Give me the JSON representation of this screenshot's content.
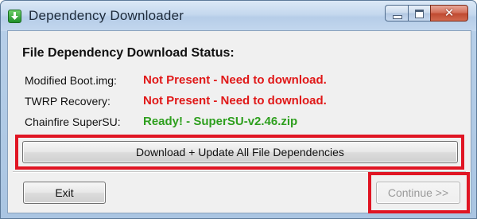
{
  "window": {
    "title": "Dependency Downloader",
    "icon": "download-arrow-icon"
  },
  "caption_buttons": {
    "minimize_icon": "minimize-icon",
    "maximize_icon": "maximize-icon",
    "close_glyph": "✕"
  },
  "heading": "File Dependency Download Status:",
  "rows": [
    {
      "label": "Modified Boot.img:",
      "status": "Not Present - Need to download.",
      "state": "missing"
    },
    {
      "label": "TWRP Recovery:",
      "status": "Not Present - Need to download.",
      "state": "missing"
    },
    {
      "label": "Chainfire SuperSU:",
      "status": "Ready! - SuperSU-v2.46.zip",
      "state": "ready"
    }
  ],
  "buttons": {
    "download_all": "Download + Update All File Dependencies",
    "exit": "Exit",
    "continue": "Continue >>",
    "continue_enabled": false
  },
  "colors": {
    "missing": "#e01818",
    "ready": "#2e9f1e",
    "highlight": "#e01523"
  }
}
